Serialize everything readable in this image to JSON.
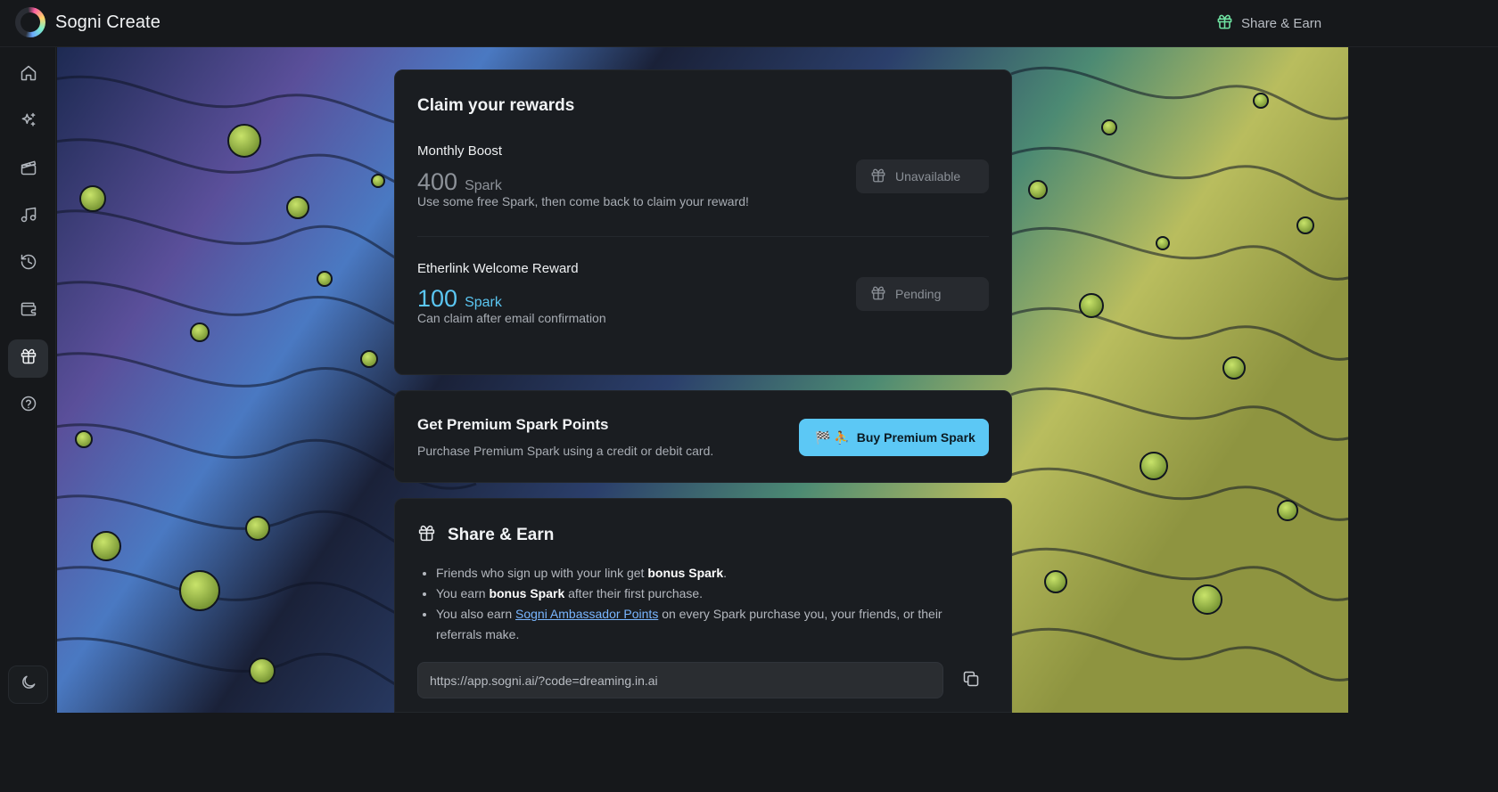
{
  "app": {
    "title": "Sogni Create"
  },
  "header": {
    "share_label": "Share & Earn"
  },
  "sidebar": {
    "items": [
      {
        "name": "home",
        "icon": "home-icon"
      },
      {
        "name": "create",
        "icon": "sparkles-icon"
      },
      {
        "name": "video",
        "icon": "clapperboard-icon"
      },
      {
        "name": "music",
        "icon": "music-note-icon"
      },
      {
        "name": "history",
        "icon": "history-icon"
      },
      {
        "name": "wallet",
        "icon": "wallet-icon"
      },
      {
        "name": "rewards",
        "icon": "gift-icon",
        "active": true
      },
      {
        "name": "help",
        "icon": "help-circle-icon"
      }
    ],
    "theme_icon": "moon-icon"
  },
  "rewards": {
    "title": "Claim your rewards",
    "monthly": {
      "title": "Monthly Boost",
      "amount": "400",
      "unit": "Spark",
      "description": "Use some free Spark, then come back to claim your reward!",
      "status": "Unavailable"
    },
    "etherlink": {
      "title": "Etherlink Welcome Reward",
      "amount": "100",
      "unit": "Spark",
      "description": "Can claim after email confirmation",
      "status": "Pending"
    }
  },
  "premium": {
    "title": "Get Premium Spark Points",
    "description": "Purchase Premium Spark using a credit or debit card.",
    "button_label": "Buy Premium Spark",
    "button_emoji": "🏁 ⛹"
  },
  "share": {
    "title": "Share & Earn",
    "bullet1_pre": "Friends who sign up with your link get ",
    "bullet1_bold": "bonus Spark",
    "bullet1_post": ".",
    "bullet2_pre": "You earn ",
    "bullet2_bold": "bonus Spark",
    "bullet2_post": " after their first purchase.",
    "bullet3_pre": "You also earn ",
    "bullet3_link": "Sogni Ambassador Points",
    "bullet3_post": " on every Spark purchase you, your friends, or their referrals make.",
    "link_value": "https://app.sogni.ai/?code=dreaming.in.ai"
  },
  "colors": {
    "accent": "#5cc8f5",
    "spark_blue": "#5bc6f2",
    "gift_green": "#6fe3a2",
    "card_bg": "#1a1d21",
    "app_bg": "#16181b"
  }
}
